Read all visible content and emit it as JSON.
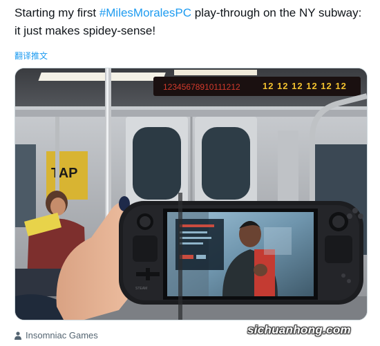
{
  "tweet": {
    "text_before": "Starting my first ",
    "hashtag": "#MilesMoralesPC",
    "text_after": " play-through on the NY subway: it just makes spidey-sense!"
  },
  "translate_label": "翻译推文",
  "photo": {
    "led_sign": "12345678910111212 12 12 12 12 12",
    "poster_text": "TAP",
    "device_brand": "STEAM"
  },
  "caption": {
    "icon": "person-icon",
    "label": "Insomniac Games"
  },
  "watermark": "sichuanhong.com",
  "colors": {
    "hashtag": "#1d9bf0",
    "text": "#0f1419",
    "muted": "#536471"
  }
}
